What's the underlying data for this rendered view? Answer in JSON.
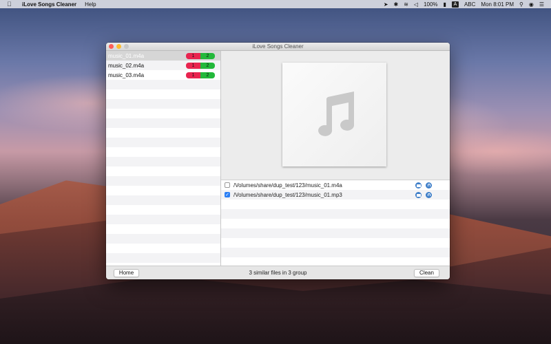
{
  "menubar": {
    "app_name": "iLove Songs Cleaner",
    "menus": [
      "Help"
    ],
    "battery": "100%",
    "input_source": "A",
    "input_label": "ABC",
    "clock": "Mon 8:01 PM"
  },
  "window": {
    "title": "iLove Songs Cleaner"
  },
  "file_list": [
    {
      "name": "music_01.m4a",
      "red_count": "1",
      "green_count": "2",
      "selected": true
    },
    {
      "name": "music_02.m4a",
      "red_count": "1",
      "green_count": "2",
      "selected": false
    },
    {
      "name": "music_03.m4a",
      "red_count": "1",
      "green_count": "2",
      "selected": false
    }
  ],
  "duplicates": [
    {
      "path": "/Volumes/share/dup_test/123/music_01.m4a",
      "checked": false
    },
    {
      "path": "/Volumes/share/dup_test/123/music_01.mp3",
      "checked": true
    }
  ],
  "bottom": {
    "home_label": "Home",
    "status": "3 similar files in 3 group",
    "clean_label": "Clean"
  },
  "colors": {
    "red_badge": "#e8244f",
    "green_badge": "#22b83a",
    "checkbox_accent": "#2a7ef4",
    "row_icon": "#3f7fc9"
  }
}
